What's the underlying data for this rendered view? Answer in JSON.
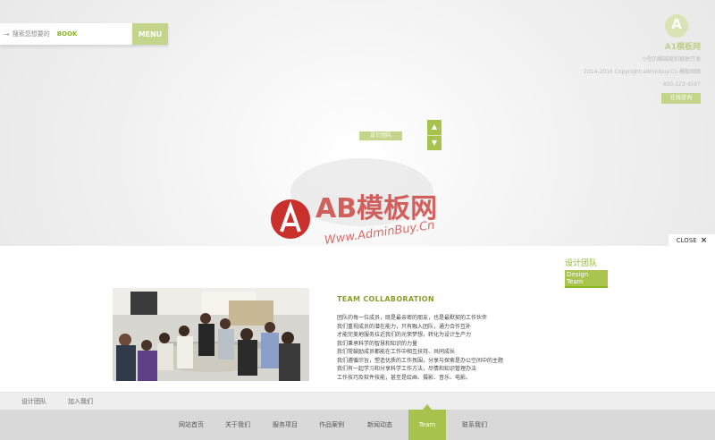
{
  "search": {
    "placeholder": "搜索您想要的",
    "book_label": "BOOK",
    "menu_label": "MENU"
  },
  "brand": {
    "logo_letter": "A",
    "name": "A1模板网",
    "lines": [
      "小型的酸碱度和极致开发",
      "2014-2016 Copyright:adminbuy.Cn 模板网络",
      "400-123-4567"
    ],
    "button_label": "在线咨询"
  },
  "slider": {
    "tag_label": "设计团队",
    "arrow_up": "▲",
    "arrow_down": "▼"
  },
  "close": {
    "label": "CLOSE",
    "icon": "×"
  },
  "section": {
    "title_cn": "设计团队",
    "title_en": "Design Team"
  },
  "collab": {
    "title": "TEAM COLLABORATION",
    "lines": [
      "团队的每一位成员，既是最亲密的朋友，也是最默契的工作伙伴",
      "我们重视成员的潜在能力，只有融入团队，通力合作互补",
      "才能完美地服务拉近我们的光荣梦想，转化为设计生产力",
      "我们秉承科学的智慧和知识的力量",
      "我们常鼓励成员都能在工作中相互扶持、共同成长",
      "我们遵循宗旨，塑造优质的工作氛围，分享与探索是办公空间中的主题",
      "我们有一起学习和分享科学工作方法，尽情和知识管理办法",
      "工作技巧及软件技能，甚至是绘画、摄影、音乐、电影。"
    ]
  },
  "subnav": [
    "设计团队",
    "加入我们"
  ],
  "footer_nav": [
    {
      "label": "网站首页",
      "active": false
    },
    {
      "label": "关于我们",
      "active": false
    },
    {
      "label": "服务项目",
      "active": false
    },
    {
      "label": "作品案例",
      "active": false
    },
    {
      "label": "新闻动态",
      "active": false
    },
    {
      "label": "Team",
      "active": true
    },
    {
      "label": "联系我们",
      "active": false
    }
  ],
  "watermark": {
    "brand": "AB模板网",
    "url": "Www.AdminBuy.Cn"
  },
  "colors": {
    "accent": "#a7c24d",
    "accent_light": "#c2d58b",
    "watermark_red": "#c9302c"
  }
}
